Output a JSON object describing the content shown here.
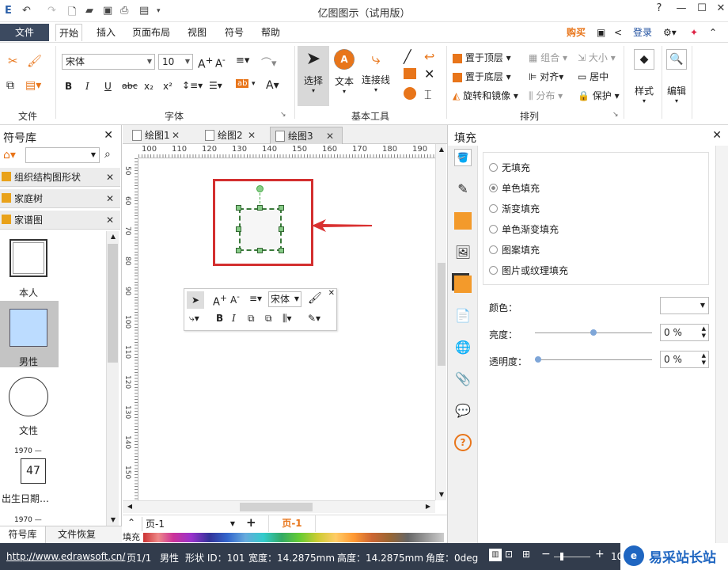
{
  "app": {
    "title": "亿图图示（试用版）"
  },
  "menu": {
    "file": "文件",
    "items": [
      "开始",
      "插入",
      "页面布局",
      "视图",
      "符号",
      "帮助"
    ],
    "buy": "购买",
    "login": "登录"
  },
  "ribbon": {
    "font_name": "宋体",
    "font_size": "10",
    "group_file": "文件",
    "group_font": "字体",
    "group_tools": "基本工具",
    "group_arrange": "排列",
    "select_label": "选择",
    "text_label": "文本",
    "connector_label": "连接线",
    "bring_front": "置于顶层",
    "send_back": "置于底层",
    "rotate_mirror": "旋转和镜像",
    "group": "组合",
    "size": "大小",
    "align": "对齐",
    "center": "居中",
    "distribute": "分布",
    "protect": "保护",
    "style": "样式",
    "edit": "编辑"
  },
  "left_panel": {
    "title": "符号库",
    "libraries": [
      "组织结构图形状",
      "家庭树",
      "家谱图"
    ],
    "shapes": [
      "本人",
      "男性",
      "文性",
      "出生日期…"
    ],
    "date_top": "1970 —",
    "date_number": "47",
    "date_bottom": "1970 —",
    "tab_library": "符号库",
    "tab_recover": "文件恢复"
  },
  "docs": {
    "tabs": [
      "绘图1",
      "绘图2",
      "绘图3"
    ],
    "active": 2
  },
  "ruler": {
    "h_ticks": [
      "100",
      "110",
      "120",
      "130",
      "140",
      "150",
      "160",
      "170",
      "180",
      "190"
    ],
    "v_ticks": [
      "50",
      "60",
      "70",
      "80",
      "90",
      "100",
      "110",
      "120",
      "130",
      "140",
      "150"
    ]
  },
  "mini_toolbar": {
    "font": "宋体"
  },
  "pagebar": {
    "page_select": "页-1",
    "page_tab": "页-1",
    "fill_label": "填充"
  },
  "fill_panel": {
    "title": "填充",
    "options": [
      "无填充",
      "单色填充",
      "渐变填充",
      "单色渐变填充",
      "图案填充",
      "图片或纹理填充"
    ],
    "selected": 1,
    "color_label": "颜色：",
    "brightness_label": "亮度：",
    "brightness_value": "0 %",
    "transparency_label": "透明度：",
    "transparency_value": "0 %"
  },
  "status": {
    "url": "http://www.edrawsoft.cn/",
    "page": "页1/1",
    "gender": "男性",
    "shape_id": "形状 ID：101",
    "width": "宽度：14.2875mm",
    "height": "高度：14.2875mm",
    "angle": "角度：0deg",
    "zoom": "10"
  },
  "watermark": {
    "text": "易采站长站"
  },
  "colors": {
    "accent": "#e8751a",
    "dark": "#323c4c",
    "selected_shape": "#bcdcff",
    "highlight_box": "#d32f2f"
  }
}
